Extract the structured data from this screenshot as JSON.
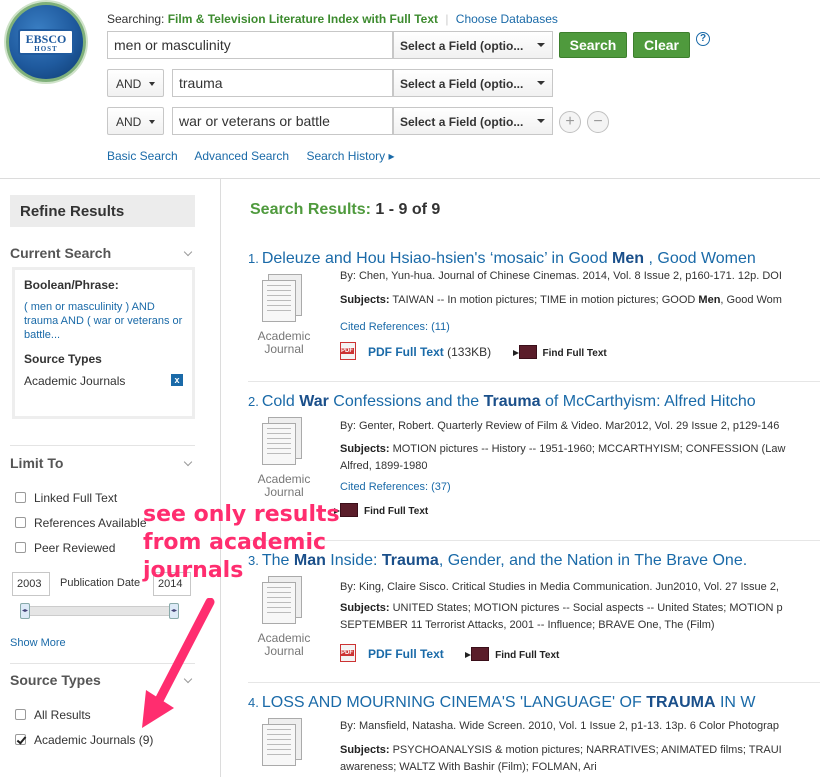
{
  "header": {
    "logo": {
      "top": "EBSCO",
      "bottom": "HOST"
    },
    "searching_label": "Searching:",
    "database": "Film & Television Literature Index with Full Text",
    "choose_databases": "Choose Databases",
    "rows": [
      {
        "operator": "",
        "query": "men or masculinity",
        "field": "Select a Field (optio..."
      },
      {
        "operator": "AND",
        "query": "trauma",
        "field": "Select a Field (optio..."
      },
      {
        "operator": "AND",
        "query": "war or veterans or battle",
        "field": "Select a Field (optio..."
      }
    ],
    "search_button": "Search",
    "clear_button": "Clear",
    "help": "?",
    "add_row": "+",
    "remove_row": "−",
    "links": {
      "basic": "Basic Search",
      "advanced": "Advanced Search",
      "history": "Search History ▸"
    }
  },
  "sidebar": {
    "refine_title": "Refine Results",
    "current_search": {
      "heading": "Current Search",
      "boolean_label": "Boolean/Phrase:",
      "query_text": "( men or masculinity ) AND trauma AND ( war or veterans or battle...",
      "source_types_label": "Source Types",
      "source_type_value": "Academic Journals",
      "remove": "x"
    },
    "limit_to": {
      "heading": "Limit To",
      "options": [
        {
          "label": "Linked Full Text",
          "checked": false
        },
        {
          "label": "References Available",
          "checked": false
        },
        {
          "label": "Peer Reviewed",
          "checked": false
        }
      ],
      "date_from": "2003",
      "date_to": "2014",
      "date_label": "Publication Date",
      "show_more": "Show More"
    },
    "source_types": {
      "heading": "Source Types",
      "options": [
        {
          "label": "All Results",
          "checked": false
        },
        {
          "label": "Academic Journals (9)",
          "checked": true
        }
      ]
    }
  },
  "annotation": {
    "line1": "see only results",
    "line2": "from academic",
    "line3": "journals",
    "color": "#ff2d6f"
  },
  "results": {
    "heading": "Search Results:",
    "count": "1 - 9 of 9",
    "items": [
      {
        "num": "1.",
        "title_parts": [
          "Deleuze and Hou Hsiao-hsien's ‘mosaic’ in Good ",
          "Men",
          " , Good Women"
        ],
        "byline": "By: Chen, Yun-hua. Journal of Chinese Cinemas. 2014, Vol. 8 Issue 2, p160-171. 12p. DOI",
        "subjects_label": "Subjects:",
        "subjects_parts": [
          " TAIWAN -- In motion pictures; TIME in motion pictures; GOOD ",
          "Men",
          ", Good Wom"
        ],
        "cited": "Cited References: (11)",
        "type": "Academic Journal",
        "pdf_label": "PDF Full Text",
        "pdf_size": "(133KB)",
        "find": "Find Full Text"
      },
      {
        "num": "2.",
        "title_parts": [
          "Cold ",
          "War",
          " Confessions and the ",
          "Trauma",
          " of McCarthyism: Alfred Hitcho"
        ],
        "byline": "By: Genter, Robert. Quarterly Review of Film & Video. Mar2012, Vol. 29 Issue 2, p129-146",
        "subjects_label": "Subjects:",
        "subjects_text": " MOTION pictures -- History -- 1951-1960; MCCARTHYISM; CONFESSION (Law",
        "subjects_line2": "Alfred, 1899-1980",
        "cited": "Cited References: (37)",
        "type": "Academic Journal",
        "find": "Find Full Text"
      },
      {
        "num": "3.",
        "title_parts": [
          "The ",
          "Man",
          " Inside: ",
          "Trauma",
          ", Gender, and the Nation in The Brave One."
        ],
        "byline": "By: King, Claire Sisco. Critical Studies in Media Communication. Jun2010, Vol. 27 Issue 2,",
        "subjects_label": "Subjects:",
        "subjects_text": " UNITED States; MOTION pictures -- Social aspects -- United States; MOTION p",
        "subjects_line2": "SEPTEMBER 11 Terrorist Attacks, 2001 -- Influence; BRAVE One, The (Film)",
        "type": "Academic Journal",
        "pdf_label": "PDF Full Text",
        "find": "Find Full Text"
      },
      {
        "num": "4.",
        "title_parts": [
          "LOSS AND MOURNING CINEMA'S 'LANGUAGE' OF ",
          "TRAUMA",
          " IN W"
        ],
        "byline": "By: Mansfield, Natasha. Wide Screen. 2010, Vol. 1 Issue 2, p1-13. 13p. 6 Color Photograp",
        "subjects_label": "Subjects:",
        "subjects_text": " PSYCHOANALYSIS & motion pictures; NARRATIVES; ANIMATED films; TRAUI",
        "subjects_line2": "awareness; WALTZ With Bashir (Film); FOLMAN, Ari"
      }
    ]
  }
}
